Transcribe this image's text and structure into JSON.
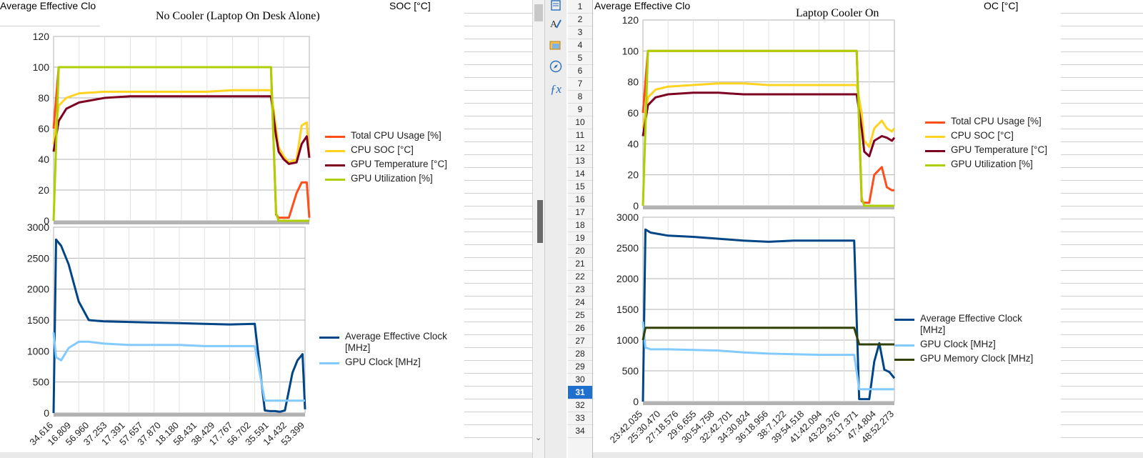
{
  "left_sheet": {
    "header_fragments": [
      {
        "name": "col-a",
        "text": "Average Effective Clo"
      },
      {
        "name": "col-soc",
        "text": "SOC [°C]"
      }
    ]
  },
  "right_sheet": {
    "header_fragments": [
      {
        "name": "col-a",
        "text": "Average Effective Clo"
      },
      {
        "name": "col-soc",
        "text": "OC [°C]"
      }
    ]
  },
  "row_numbers": [
    "1",
    "2",
    "3",
    "4",
    "5",
    "6",
    "7",
    "8",
    "9",
    "10",
    "11",
    "12",
    "13",
    "14",
    "15",
    "16",
    "17",
    "18",
    "19",
    "20",
    "21",
    "22",
    "23",
    "24",
    "25",
    "26",
    "27",
    "28",
    "29",
    "30",
    "31",
    "32",
    "33",
    "34"
  ],
  "active_row": "31",
  "sidebar_icons": [
    "properties-icon",
    "styles-icon",
    "gallery-icon",
    "navigator-icon",
    "functions-icon"
  ],
  "colors": {
    "cpu_usage": "#ff4e1a",
    "cpu_soc": "#ffd320",
    "gpu_temp": "#7e0021",
    "gpu_util": "#aecf00",
    "avg_clock": "#004586",
    "gpu_clock": "#83caff",
    "gpu_mem_clock": "#314004",
    "axis_band": "#b3b3b3",
    "active_row": "#1f6fcf"
  },
  "chart_data": [
    {
      "id": "left-top",
      "type": "line",
      "title": "No Cooler (Laptop On Desk Alone)",
      "ylim": [
        0,
        120
      ],
      "yticks": [
        "0",
        "20",
        "40",
        "60",
        "80",
        "100",
        "120"
      ],
      "xlabels": [],
      "grid": true,
      "legend_position": "right",
      "x": [
        0,
        0.02,
        0.05,
        0.1,
        0.2,
        0.3,
        0.4,
        0.5,
        0.6,
        0.7,
        0.8,
        0.85,
        0.87,
        0.88,
        0.9,
        0.92,
        0.95,
        0.97,
        0.99,
        1.0
      ],
      "series": [
        {
          "name": "Total CPU Usage [%]",
          "color": "#ff4e1a",
          "values": [
            60,
            100,
            100,
            100,
            100,
            100,
            100,
            100,
            100,
            100,
            100,
            100,
            4,
            2,
            2,
            2,
            18,
            25,
            25,
            2
          ]
        },
        {
          "name": "CPU SOC [°C]",
          "color": "#ffd320",
          "values": [
            50,
            75,
            80,
            83,
            84,
            84,
            84,
            84,
            84,
            85,
            85,
            85,
            60,
            48,
            42,
            38,
            40,
            62,
            64,
            42
          ]
        },
        {
          "name": "GPU Temperature [°C]",
          "color": "#7e0021",
          "values": [
            45,
            65,
            73,
            77,
            80,
            81,
            81,
            81,
            81,
            81,
            81,
            81,
            55,
            45,
            40,
            37,
            38,
            50,
            55,
            41
          ]
        },
        {
          "name": "GPU Utilization [%]",
          "color": "#aecf00",
          "values": [
            0,
            100,
            100,
            100,
            100,
            100,
            100,
            100,
            100,
            100,
            100,
            100,
            5,
            0,
            0,
            0,
            0,
            0,
            0,
            0
          ]
        }
      ]
    },
    {
      "id": "left-bottom",
      "type": "line",
      "ylim": [
        0,
        3000
      ],
      "yticks": [
        "0",
        "500",
        "1000",
        "1500",
        "2000",
        "2500",
        "3000"
      ],
      "xlabels": [
        "34.616",
        "16.809",
        "56.960",
        "37.253",
        "17.391",
        "57.657",
        "37.870",
        "18.180",
        "58.431",
        "38.429",
        "17.767",
        "56.702",
        "35.591",
        "14.432",
        "53.399"
      ],
      "grid": true,
      "legend_position": "right",
      "x": [
        0,
        0.01,
        0.03,
        0.06,
        0.1,
        0.14,
        0.2,
        0.3,
        0.4,
        0.5,
        0.6,
        0.7,
        0.8,
        0.84,
        0.86,
        0.88,
        0.9,
        0.92,
        0.95,
        0.97,
        0.99,
        1.0
      ],
      "series": [
        {
          "name": "Average Effective Clock [MHz]",
          "color": "#004586",
          "values": [
            0,
            2800,
            2700,
            2400,
            1800,
            1500,
            1480,
            1470,
            1460,
            1450,
            1440,
            1430,
            1440,
            40,
            30,
            30,
            20,
            40,
            650,
            850,
            950,
            60
          ]
        },
        {
          "name": "GPU Clock [MHz]",
          "color": "#83caff",
          "values": [
            1300,
            900,
            850,
            1050,
            1150,
            1150,
            1120,
            1100,
            1100,
            1100,
            1080,
            1080,
            1080,
            200,
            200,
            200,
            200,
            200,
            200,
            200,
            200,
            200
          ]
        }
      ]
    },
    {
      "id": "right-top",
      "type": "line",
      "title": "Laptop Cooler On",
      "ylim": [
        0,
        120
      ],
      "yticks": [
        "0",
        "20",
        "40",
        "60",
        "80",
        "100",
        "120"
      ],
      "xlabels": [],
      "grid": true,
      "legend_position": "right",
      "x": [
        0,
        0.02,
        0.05,
        0.1,
        0.2,
        0.3,
        0.4,
        0.5,
        0.6,
        0.7,
        0.8,
        0.85,
        0.87,
        0.88,
        0.9,
        0.92,
        0.95,
        0.97,
        0.99,
        1.0
      ],
      "series": [
        {
          "name": "Total CPU Usage [%]",
          "color": "#ff4e1a",
          "values": [
            60,
            100,
            100,
            100,
            100,
            100,
            100,
            100,
            100,
            100,
            100,
            100,
            3,
            2,
            2,
            20,
            25,
            12,
            10,
            10
          ]
        },
        {
          "name": "CPU SOC [°C]",
          "color": "#ffd320",
          "values": [
            50,
            70,
            75,
            77,
            78,
            79,
            79,
            78,
            78,
            78,
            78,
            78,
            60,
            42,
            38,
            50,
            55,
            50,
            48,
            50
          ]
        },
        {
          "name": "GPU Temperature [°C]",
          "color": "#7e0021",
          "values": [
            45,
            65,
            70,
            72,
            73,
            73,
            72,
            72,
            72,
            72,
            72,
            72,
            50,
            35,
            32,
            42,
            45,
            44,
            42,
            44
          ]
        },
        {
          "name": "GPU Utilization [%]",
          "color": "#aecf00",
          "values": [
            0,
            100,
            100,
            100,
            100,
            100,
            100,
            100,
            100,
            100,
            100,
            100,
            5,
            0,
            0,
            0,
            0,
            0,
            0,
            0
          ]
        }
      ]
    },
    {
      "id": "right-bottom",
      "type": "line",
      "ylim": [
        0,
        3000
      ],
      "yticks": [
        "0",
        "500",
        "1000",
        "1500",
        "2000",
        "2500",
        "3000"
      ],
      "xlabels": [
        "23:42.035",
        "25:30.470",
        "27:18.576",
        "29:6.655",
        "30:54.758",
        "32:42.701",
        "34:30.824",
        "36:18.956",
        "38:7.122",
        "39:54.518",
        "41:42.094",
        "43:29.376",
        "45:17.371",
        "47:4.804",
        "48:52.273"
      ],
      "grid": true,
      "legend_position": "right",
      "x": [
        0,
        0.01,
        0.03,
        0.1,
        0.2,
        0.3,
        0.4,
        0.5,
        0.6,
        0.7,
        0.8,
        0.84,
        0.86,
        0.88,
        0.9,
        0.92,
        0.94,
        0.96,
        0.98,
        1.0
      ],
      "series": [
        {
          "name": "Average Effective Clock [MHz]",
          "color": "#004586",
          "values": [
            0,
            2800,
            2750,
            2700,
            2680,
            2650,
            2620,
            2600,
            2620,
            2620,
            2620,
            2620,
            40,
            40,
            40,
            650,
            950,
            520,
            480,
            380
          ]
        },
        {
          "name": "GPU Clock [MHz]",
          "color": "#83caff",
          "values": [
            1300,
            880,
            850,
            850,
            840,
            830,
            800,
            780,
            770,
            760,
            760,
            760,
            200,
            200,
            200,
            200,
            200,
            200,
            200,
            200
          ]
        },
        {
          "name": "GPU Memory Clock [MHz]",
          "color": "#314004",
          "values": [
            1000,
            1200,
            1200,
            1200,
            1200,
            1200,
            1200,
            1200,
            1200,
            1200,
            1200,
            1200,
            930,
            930,
            930,
            930,
            930,
            930,
            930,
            930
          ]
        }
      ]
    }
  ]
}
